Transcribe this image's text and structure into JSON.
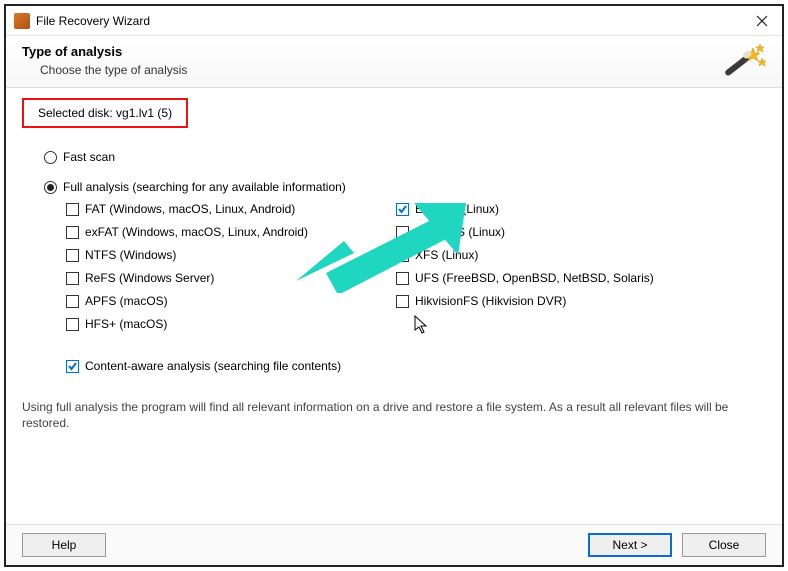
{
  "window": {
    "title": "File Recovery Wizard"
  },
  "header": {
    "heading": "Type of analysis",
    "subtitle": "Choose the type of analysis"
  },
  "selected_disk": {
    "prefix": "Selected disk: ",
    "value": "vg1.lv1 (5)"
  },
  "scan_modes": {
    "fast": {
      "label": "Fast scan",
      "checked": false
    },
    "full": {
      "label": "Full analysis (searching for any available information)",
      "checked": true
    }
  },
  "filesystems": {
    "left": [
      {
        "label": "FAT (Windows, macOS, Linux, Android)",
        "checked": false
      },
      {
        "label": "exFAT (Windows, macOS, Linux, Android)",
        "checked": false
      },
      {
        "label": "NTFS (Windows)",
        "checked": false
      },
      {
        "label": "ReFS (Windows Server)",
        "checked": false
      },
      {
        "label": "APFS (macOS)",
        "checked": false
      },
      {
        "label": "HFS+ (macOS)",
        "checked": false
      }
    ],
    "right": [
      {
        "label": "Ext2/3/4 (Linux)",
        "checked": true
      },
      {
        "label": "ReiserFS (Linux)",
        "checked": false
      },
      {
        "label": "XFS (Linux)",
        "checked": false
      },
      {
        "label": "UFS (FreeBSD, OpenBSD, NetBSD, Solaris)",
        "checked": false
      },
      {
        "label": "HikvisionFS (Hikvision DVR)",
        "checked": false
      }
    ]
  },
  "content_aware": {
    "label": "Content-aware analysis (searching file contents)",
    "checked": true
  },
  "description": "Using full analysis the program will find all relevant information on a drive and restore a file system. As a result all relevant files will be restored.",
  "buttons": {
    "help": "Help",
    "next": "Next >",
    "close": "Close"
  },
  "colors": {
    "highlight_border": "#e11",
    "accent": "#0a6ad6",
    "arrow": "#1fd6c0"
  }
}
